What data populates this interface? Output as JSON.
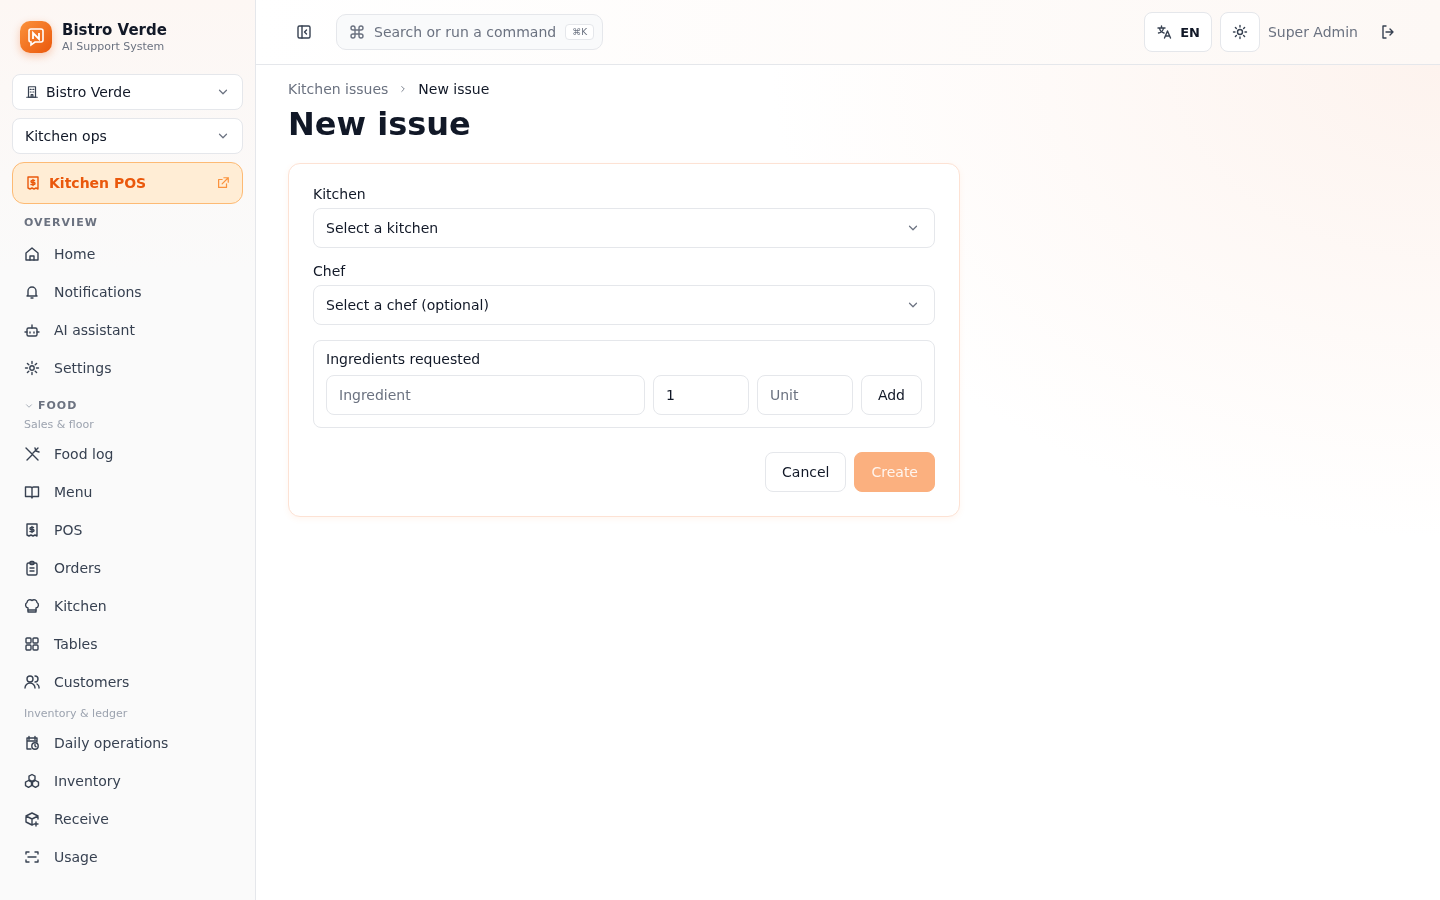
{
  "brand": {
    "name": "Bistro Verde",
    "subtitle": "AI Support System"
  },
  "switchers": [
    {
      "label": "Bistro Verde",
      "kind": "venue"
    },
    {
      "label": "Kitchen ops",
      "kind": "plain"
    }
  ],
  "pinned_link": {
    "label": "Kitchen POS"
  },
  "sidebar": {
    "sections": [
      {
        "title": "OVERVIEW",
        "groups": [
          {
            "items": [
              {
                "label": "Home",
                "selected": false
              },
              {
                "label": "Notifications",
                "selected": false
              },
              {
                "label": "AI assistant",
                "selected": false
              },
              {
                "label": "Settings",
                "selected": false
              }
            ]
          }
        ]
      },
      {
        "title": "FOOD",
        "expanded": true,
        "groups": [
          {
            "title": "Sales & floor",
            "items": [
              {
                "label": "Food log",
                "selected": false
              },
              {
                "label": "Menu",
                "selected": false
              },
              {
                "label": "POS",
                "selected": false
              },
              {
                "label": "Orders",
                "selected": false
              },
              {
                "label": "Kitchen",
                "selected": false
              },
              {
                "label": "Tables",
                "selected": false
              },
              {
                "label": "Customers",
                "selected": false
              }
            ]
          },
          {
            "title": "Inventory & ledger",
            "items": [
              {
                "label": "Daily operations",
                "selected": false
              },
              {
                "label": "Inventory",
                "selected": false
              },
              {
                "label": "Receive",
                "selected": false
              },
              {
                "label": "Usage",
                "selected": false
              }
            ]
          }
        ]
      }
    ]
  },
  "topbar": {
    "search": {
      "placeholder": "Search or run a command",
      "shortcut": "⌘K"
    },
    "language": "EN",
    "user": "Super Admin"
  },
  "breadcrumb": [
    {
      "label": "Kitchen issues",
      "current": false
    },
    {
      "label": "New issue",
      "current": true
    }
  ],
  "page_title": "New issue",
  "form": {
    "fields": [
      {
        "label": "Kitchen",
        "value": "Select a kitchen"
      },
      {
        "label": "Chef",
        "value": "Select a chef (optional)"
      }
    ],
    "ingredients": {
      "title": "Ingredients requested",
      "name": {
        "placeholder": "Ingredient"
      },
      "quantity": {
        "value": "1"
      },
      "unit": {
        "placeholder": "Unit"
      },
      "add_button": "Add"
    },
    "buttons": [
      {
        "label": "Cancel",
        "kind": "secondary",
        "disabled": false
      },
      {
        "label": "Create",
        "kind": "primary",
        "disabled": true
      }
    ]
  }
}
